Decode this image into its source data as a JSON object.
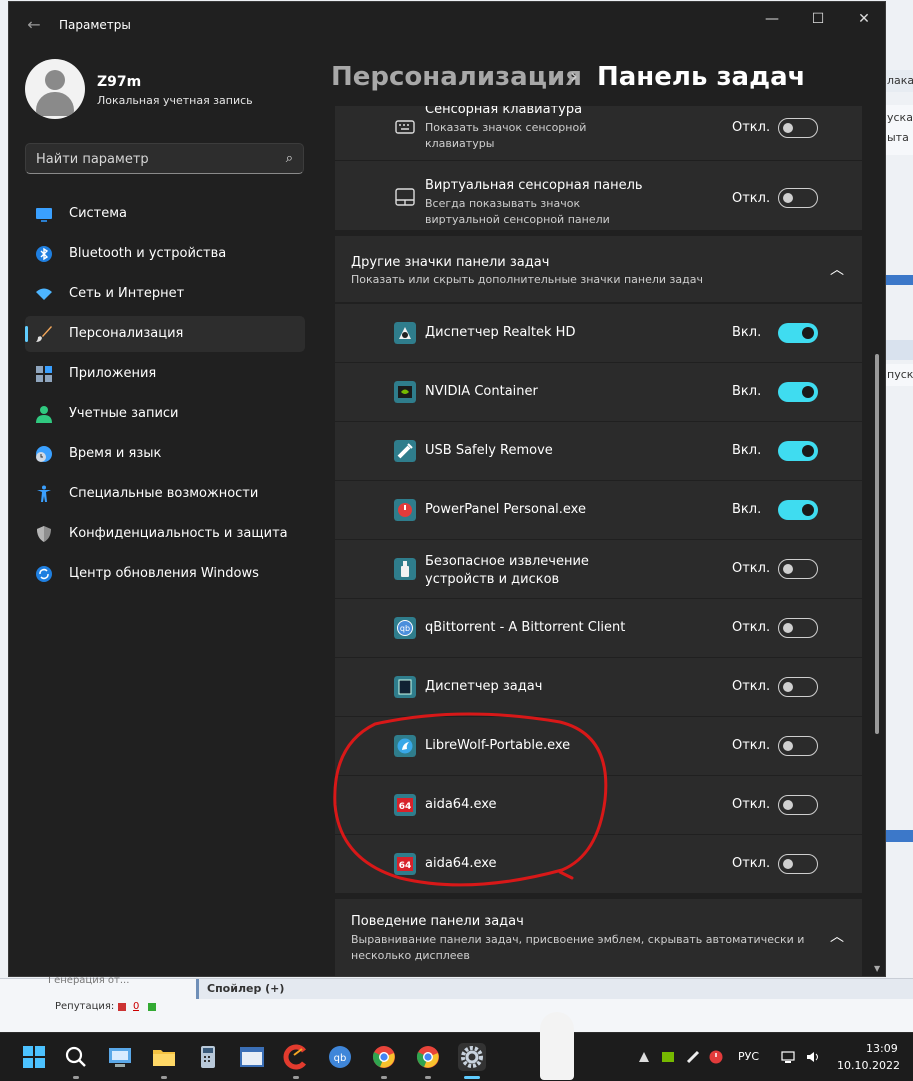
{
  "background_page": {
    "right_fragments": [
      "лака",
      "уска",
      "ыта (",
      "пуск"
    ],
    "spoiler_label": "Спойлер (+)",
    "rep_label": "Репутация:",
    "rep_values": [
      "0"
    ],
    "faded_line": "Генерация от..."
  },
  "window": {
    "app_title": "Параметры",
    "controls": {
      "minimize": "—",
      "maximize": "☐",
      "close": "✕"
    }
  },
  "user": {
    "name": "Z97m",
    "account_type": "Локальная учетная запись"
  },
  "search": {
    "placeholder": "Найти параметр"
  },
  "nav": {
    "items": [
      {
        "label": "Система",
        "icon": "monitor-icon",
        "color": "#3aa0ff"
      },
      {
        "label": "Bluetooth и устройства",
        "icon": "bluetooth-icon",
        "color": "#3aa0ff"
      },
      {
        "label": "Сеть и Интернет",
        "icon": "wifi-icon",
        "color": "#4db5ff"
      },
      {
        "label": "Персонализация",
        "icon": "brush-icon",
        "color": "#f2a65a",
        "active": true
      },
      {
        "label": "Приложения",
        "icon": "apps-icon",
        "color": "#8fa5bd"
      },
      {
        "label": "Учетные записи",
        "icon": "person-icon",
        "color": "#30c980"
      },
      {
        "label": "Время и язык",
        "icon": "globe-clock-icon",
        "color": "#3aa0ff"
      },
      {
        "label": "Специальные возможности",
        "icon": "accessibility-icon",
        "color": "#3aa0ff"
      },
      {
        "label": "Конфиденциальность и защита",
        "icon": "shield-icon",
        "color": "#8f8f8f"
      },
      {
        "label": "Центр обновления Windows",
        "icon": "update-icon",
        "color": "#3aa0ff"
      }
    ]
  },
  "header": {
    "parent": "Персонализация",
    "separator": "›",
    "current": "Панель задач"
  },
  "top_rows": [
    {
      "title": "Сенсорная клавиатура",
      "subtitle": "Показать значок сенсорной клавиатуры",
      "state": "Откл.",
      "on": false,
      "icon": "keyboard-icon"
    },
    {
      "title": "Виртуальная сенсорная панель",
      "subtitle": "Всегда показывать значок виртуальной сенсорной панели",
      "state": "Откл.",
      "on": false,
      "icon": "touchpad-icon"
    }
  ],
  "other_icons": {
    "title": "Другие значки панели задач",
    "subtitle": "Показать или скрыть дополнительные значки панели задач",
    "chevron": "︿",
    "items": [
      {
        "title": "Диспетчер Realtek HD",
        "state": "Вкл.",
        "on": true,
        "icon": "realtek-icon"
      },
      {
        "title": "NVIDIA Container",
        "state": "Вкл.",
        "on": true,
        "icon": "nvidia-icon"
      },
      {
        "title": "USB Safely Remove",
        "state": "Вкл.",
        "on": true,
        "icon": "usb-remove-icon"
      },
      {
        "title": "PowerPanel Personal.exe",
        "state": "Вкл.",
        "on": true,
        "icon": "power-icon"
      },
      {
        "title": "Безопасное извлечение устройств и дисков",
        "state": "Откл.",
        "on": false,
        "icon": "usb-drive-icon"
      },
      {
        "title": "qBittorrent - A Bittorrent Client",
        "state": "Откл.",
        "on": false,
        "icon": "qbittorrent-icon"
      },
      {
        "title": "Диспетчер задач",
        "state": "Откл.",
        "on": false,
        "icon": "task-manager-icon"
      },
      {
        "title": "LibreWolf-Portable.exe",
        "state": "Откл.",
        "on": false,
        "icon": "librewolf-icon"
      },
      {
        "title": "aida64.exe",
        "state": "Откл.",
        "on": false,
        "icon": "aida64-icon",
        "badge": "64"
      },
      {
        "title": "aida64.exe",
        "state": "Откл.",
        "on": false,
        "icon": "aida64-icon",
        "badge": "64"
      }
    ]
  },
  "behavior": {
    "title": "Поведение панели задач",
    "subtitle": "Выравнивание панели задач, присвоение эмблем, скрывать автоматически и несколько дисплеев",
    "chevron": "︿"
  },
  "taskbar": {
    "apps": [
      "start-icon",
      "search-icon",
      "remote-desktop-icon",
      "file-explorer-icon",
      "calculator-icon",
      "window-app-icon",
      "ccleaner-icon",
      "qbittorrent-icon",
      "chrome-icon",
      "chrome-icon",
      "settings-icon"
    ],
    "active_app": "settings-icon",
    "tray": [
      "realtek-icon",
      "nvidia-icon",
      "usb-remove-icon",
      "power-icon"
    ],
    "language": "РУС",
    "time": "13:09",
    "date": "10.10.2022"
  }
}
